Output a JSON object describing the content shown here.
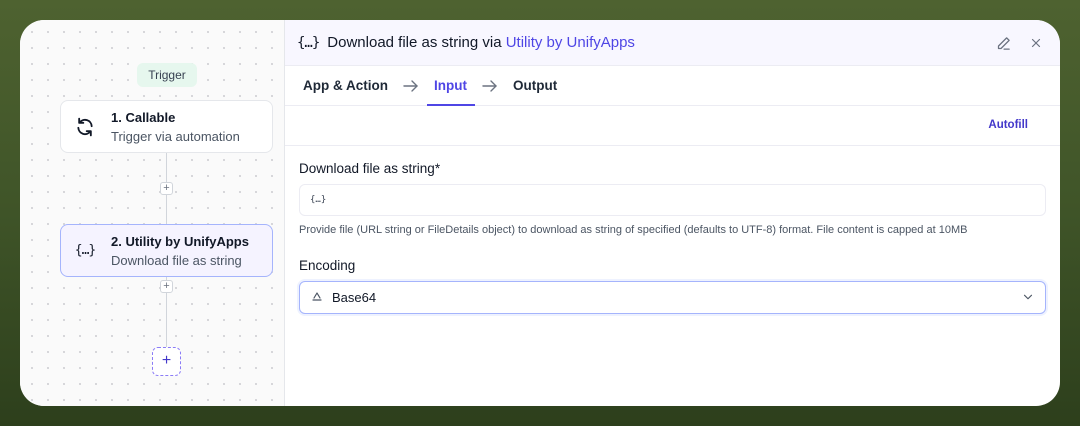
{
  "canvas": {
    "trigger_label": "Trigger",
    "nodes": [
      {
        "title": "1. Callable",
        "subtitle": "Trigger via automation",
        "icon": "refresh-icon"
      },
      {
        "title": "2. Utility by UnifyApps",
        "subtitle": "Download file as string",
        "icon": "braces-icon"
      }
    ],
    "braces_glyph": "{…}",
    "plus_glyph": "+",
    "add_glyph": "+"
  },
  "panel": {
    "header_glyph": "{…}",
    "title_prefix": "Download file as string via ",
    "title_link": "Utility by UnifyApps",
    "tabs": [
      "App & Action",
      "Input",
      "Output"
    ],
    "active_tab": "Input",
    "autofill_label": "Autofill",
    "fields": {
      "download_label": "Download file as string*",
      "download_value": "{…}",
      "download_hint": "Provide file (URL string or FileDetails object) to download as string of specified (defaults to UTF-8) format. File content is capped at 10MB",
      "encoding_label": "Encoding",
      "encoding_value": "Base64"
    }
  },
  "colors": {
    "accent": "#4f46e5",
    "trigger_bg": "#e6f7ee",
    "background": "#3f5428"
  }
}
